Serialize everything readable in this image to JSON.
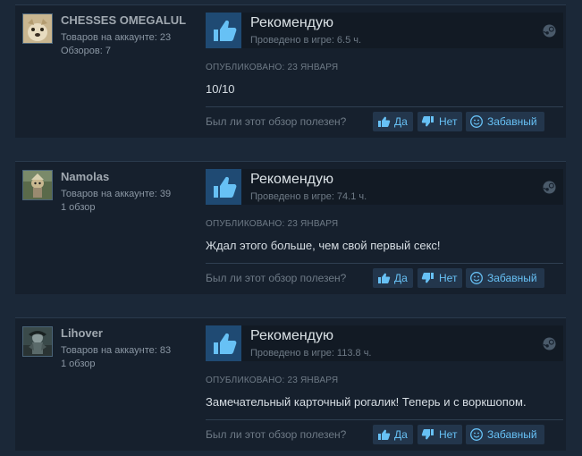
{
  "colors": {
    "page_bg": "#1b2838",
    "card_bg": "#16202d",
    "accent": "#67c1f5",
    "thumb_bg": "#1f3a55"
  },
  "reviews": [
    {
      "username": "CHESSES OMEGALUL",
      "stat1": "Товаров на аккаунте: 23",
      "stat2": "Обзоров: 7",
      "recommendation": "Рекомендую",
      "playtime": "Проведено в игре: 6.5 ч.",
      "posted": "Опубликовано: 23 января",
      "text": "10/10",
      "helpful_question": "Был ли этот обзор полезен?",
      "btn_yes": "Да",
      "btn_no": "Нет",
      "btn_funny": "Забавный",
      "avatar_icon": "dog-avatar-icon"
    },
    {
      "username": "Namolas",
      "stat1": "Товаров на аккаунте: 39",
      "stat2": "1 обзор",
      "recommendation": "Рекомендую",
      "playtime": "Проведено в игре: 74.1 ч.",
      "posted": "Опубликовано: 23 января",
      "text": "Ждал этого больше, чем свой первый секс!",
      "helpful_question": "Был ли этот обзор полезен?",
      "btn_yes": "Да",
      "btn_no": "Нет",
      "btn_funny": "Забавный",
      "avatar_icon": "character-avatar-icon"
    },
    {
      "username": "Lihover",
      "stat1": "Товаров на аккаунте: 83",
      "stat2": "1 обзор",
      "recommendation": "Рекомендую",
      "playtime": "Проведено в игре: 113.8 ч.",
      "posted": "Опубликовано: 23 января",
      "text": "Замечательный карточный рогалик! Теперь и с воркшопом.",
      "helpful_question": "Был ли этот обзор полезен?",
      "btn_yes": "Да",
      "btn_no": "Нет",
      "btn_funny": "Забавный",
      "avatar_icon": "character-avatar-icon"
    }
  ]
}
